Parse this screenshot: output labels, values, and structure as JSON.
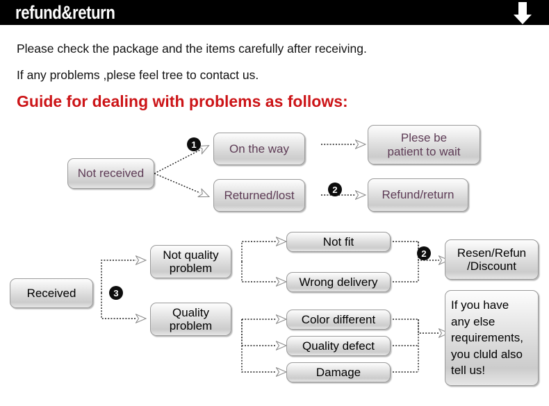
{
  "header": {
    "title": "refund&return",
    "arrow_icon": "down-arrow-icon",
    "background": "#000000",
    "text_color": "#ffffff"
  },
  "intro": {
    "line1": "Please check the package and the items carefully after receiving.",
    "line2": "If any problems ,plese feel tree to contact us.",
    "guide_title": "Guide for dealing with problems as follows:",
    "guide_color": "#cc1417"
  },
  "flow_top": {
    "start": "Not received",
    "branches": [
      {
        "badge": "❶",
        "state": "On the way",
        "result": "Plese be\npatient to wait"
      },
      {
        "badge": "❷",
        "state": "Returned/lost",
        "result": "Refund/return"
      }
    ],
    "state_on_the_way": "On the way",
    "state_returned_lost": "Returned/lost",
    "result_wait_line1": "Plese be",
    "result_wait_line2": "patient to wait",
    "result_refund": "Refund/return",
    "badge1": "1",
    "badge2": "2"
  },
  "flow_bottom": {
    "start": "Received",
    "badge3": "3",
    "badge2": "2",
    "category_not_quality_l1": "Not quality",
    "category_not_quality_l2": "problem",
    "category_quality_l1": "Quality",
    "category_quality_l2": "problem",
    "issues_not_quality": [
      "Not fit",
      "Wrong delivery"
    ],
    "issues_quality": [
      "Color different",
      "Quality defect",
      "Damage"
    ],
    "issue_not_fit": "Not fit",
    "issue_wrong_delivery": "Wrong delivery",
    "issue_color_different": "Color different",
    "issue_quality_defect": "Quality defect",
    "issue_damage": "Damage",
    "outcome_resend_l1": "Resen/Refun",
    "outcome_resend_l2": "/Discount",
    "outcome_contact_l1": "If you have",
    "outcome_contact_l2": "any else",
    "outcome_contact_l3": "requirements,",
    "outcome_contact_l4": "you cluld also",
    "outcome_contact_l5": "tell us!"
  },
  "style": {
    "box_text_color": "#000000",
    "box_text_color_purple": "#5d3b55",
    "box_border": "#9a9a9a",
    "connector_color": "#1a1a1a"
  }
}
